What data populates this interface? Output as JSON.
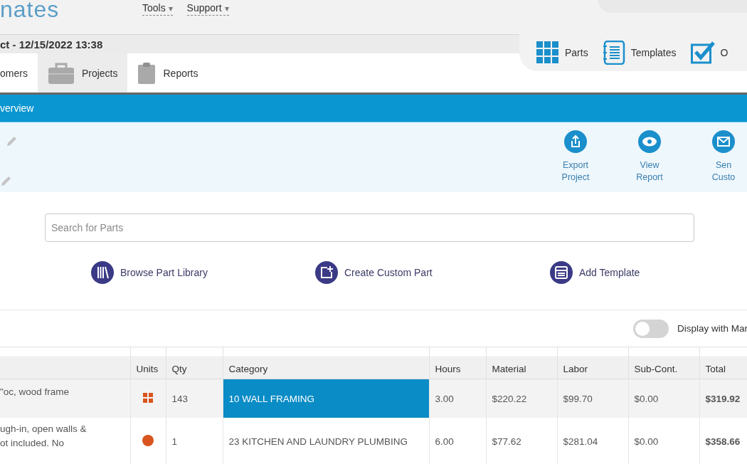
{
  "header": {
    "logo": "nates",
    "menu": [
      {
        "label": "Tools",
        "caret": "▾"
      },
      {
        "label": "Support",
        "caret": "▾"
      }
    ]
  },
  "project_title": "ct - 12/15/2022 13:38",
  "quick_links": [
    {
      "label": "Parts",
      "kind": "grid"
    },
    {
      "label": "Templates",
      "kind": "notebook"
    },
    {
      "label": "O",
      "kind": "check"
    }
  ],
  "tabs": [
    {
      "label": "omers",
      "kind": "none",
      "selected": false
    },
    {
      "label": "Projects",
      "kind": "briefcase",
      "selected": true
    },
    {
      "label": "Reports",
      "kind": "clipboard",
      "selected": false
    }
  ],
  "section_title": "verview",
  "actions": [
    {
      "label": "Export Project",
      "kind": "export"
    },
    {
      "label": "View Report",
      "kind": "eye"
    },
    {
      "label": "Sen\nCusto",
      "kind": "mail"
    }
  ],
  "search": {
    "placeholder": "Search for Parts"
  },
  "part_actions": [
    {
      "label": "Browse Part Library",
      "kind": "library"
    },
    {
      "label": "Create Custom Part",
      "kind": "create"
    },
    {
      "label": "Add Template",
      "kind": "template"
    }
  ],
  "markup_toggle": {
    "label": "Display with Mar",
    "on": false
  },
  "table": {
    "columns": [
      "",
      "Units",
      "Qty",
      "Category",
      "Hours",
      "Material",
      "Labor",
      "Sub-Cont.",
      "Total"
    ],
    "rows": [
      {
        "description": "\"oc, wood frame",
        "kind": "grid",
        "qty": "143",
        "category": "10 WALL FRAMING",
        "selected": true,
        "hours": "3.00",
        "material": "$220.22",
        "labor": "$99.70",
        "subcont": "$0.00",
        "total": "$319.92"
      },
      {
        "description": "ugh-in, open walls &\not included. No",
        "kind": "dot",
        "qty": "1",
        "category": "23 KITCHEN AND LAUNDRY PLUMBING",
        "selected": false,
        "hours": "6.00",
        "material": "$77.62",
        "labor": "$281.04",
        "subcont": "$0.00",
        "total": "$358.66"
      }
    ]
  }
}
